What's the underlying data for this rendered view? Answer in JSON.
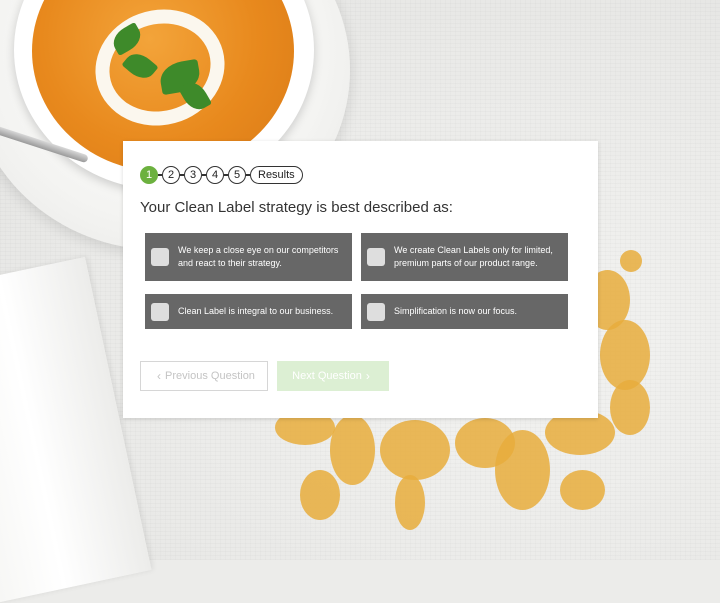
{
  "progress": {
    "steps": [
      "1",
      "2",
      "3",
      "4",
      "5"
    ],
    "active_index": 0,
    "results_label": "Results"
  },
  "question": "Your Clean Label strategy is best described as:",
  "options": [
    "We keep a close eye on our competitors and react to their strategy.",
    "We create Clean Labels only for limited, premium parts of our product range.",
    "Clean Label is integral to our business.",
    "Simplification is now our focus."
  ],
  "buttons": {
    "previous": "Previous Question",
    "next": "Next Question"
  },
  "colors": {
    "accent": "#6cb13f",
    "option_bg": "#676767",
    "next_disabled_bg": "#dcefd3"
  }
}
